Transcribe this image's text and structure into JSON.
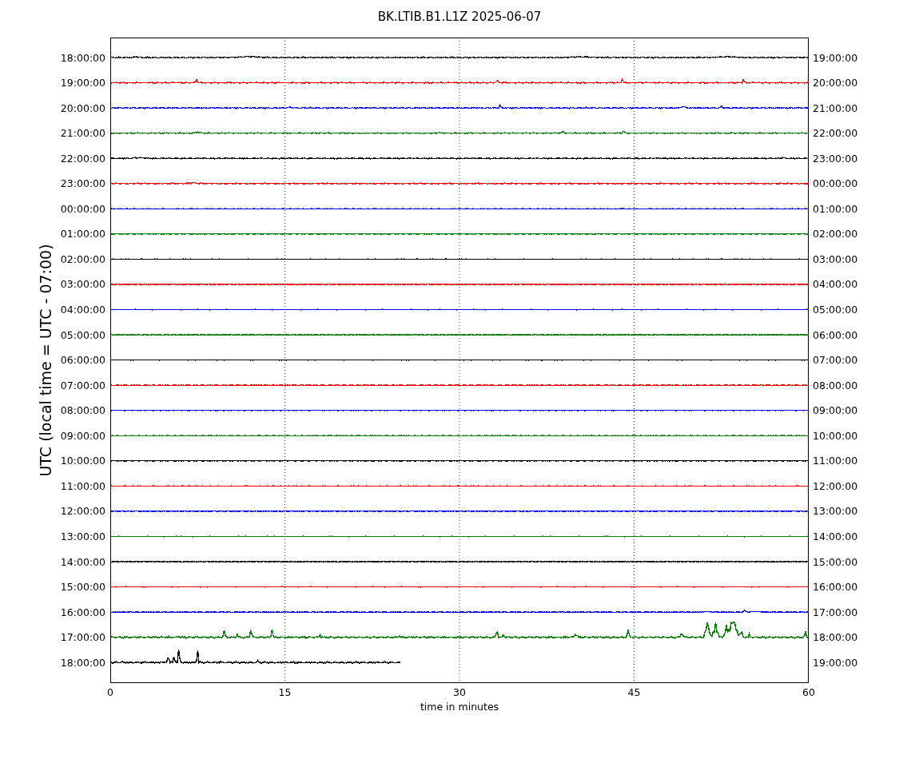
{
  "title": "BK.LTIB.B1.L1Z 2025-06-07",
  "y_axis_label": "UTC (local time = UTC - 07:00)",
  "x_axis_label": "time in minutes",
  "x_ticks": [
    "0",
    "15",
    "30",
    "45",
    "60"
  ],
  "rows": [
    {
      "left_label": "18:00:00",
      "right_label": "19:00:00",
      "color": "#000000"
    },
    {
      "left_label": "19:00:00",
      "right_label": "20:00:00",
      "color": "#ff0000"
    },
    {
      "left_label": "20:00:00",
      "right_label": "21:00:00",
      "color": "#0000ff"
    },
    {
      "left_label": "21:00:00",
      "right_label": "22:00:00",
      "color": "#008000"
    },
    {
      "left_label": "22:00:00",
      "right_label": "23:00:00",
      "color": "#000000"
    },
    {
      "left_label": "23:00:00",
      "right_label": "00:00:00",
      "color": "#ff0000"
    },
    {
      "left_label": "00:00:00",
      "right_label": "01:00:00",
      "color": "#0000ff"
    },
    {
      "left_label": "01:00:00",
      "right_label": "02:00:00",
      "color": "#008000"
    },
    {
      "left_label": "02:00:00",
      "right_label": "03:00:00",
      "color": "#000000"
    },
    {
      "left_label": "03:00:00",
      "right_label": "04:00:00",
      "color": "#ff0000"
    },
    {
      "left_label": "04:00:00",
      "right_label": "05:00:00",
      "color": "#0000ff"
    },
    {
      "left_label": "05:00:00",
      "right_label": "06:00:00",
      "color": "#008000"
    },
    {
      "left_label": "06:00:00",
      "right_label": "07:00:00",
      "color": "#000000"
    },
    {
      "left_label": "07:00:00",
      "right_label": "08:00:00",
      "color": "#ff0000"
    },
    {
      "left_label": "08:00:00",
      "right_label": "09:00:00",
      "color": "#0000ff"
    },
    {
      "left_label": "09:00:00",
      "right_label": "10:00:00",
      "color": "#008000"
    },
    {
      "left_label": "10:00:00",
      "right_label": "11:00:00",
      "color": "#000000"
    },
    {
      "left_label": "11:00:00",
      "right_label": "12:00:00",
      "color": "#ff0000"
    },
    {
      "left_label": "12:00:00",
      "right_label": "13:00:00",
      "color": "#0000ff"
    },
    {
      "left_label": "13:00:00",
      "right_label": "14:00:00",
      "color": "#008000"
    },
    {
      "left_label": "14:00:00",
      "right_label": "15:00:00",
      "color": "#000000"
    },
    {
      "left_label": "15:00:00",
      "right_label": "16:00:00",
      "color": "#ff0000"
    },
    {
      "left_label": "16:00:00",
      "right_label": "17:00:00",
      "color": "#0000ff"
    },
    {
      "left_label": "17:00:00",
      "right_label": "18:00:00",
      "color": "#008000"
    },
    {
      "left_label": "18:00:00",
      "right_label": "19:00:00",
      "color": "#000000"
    }
  ]
}
